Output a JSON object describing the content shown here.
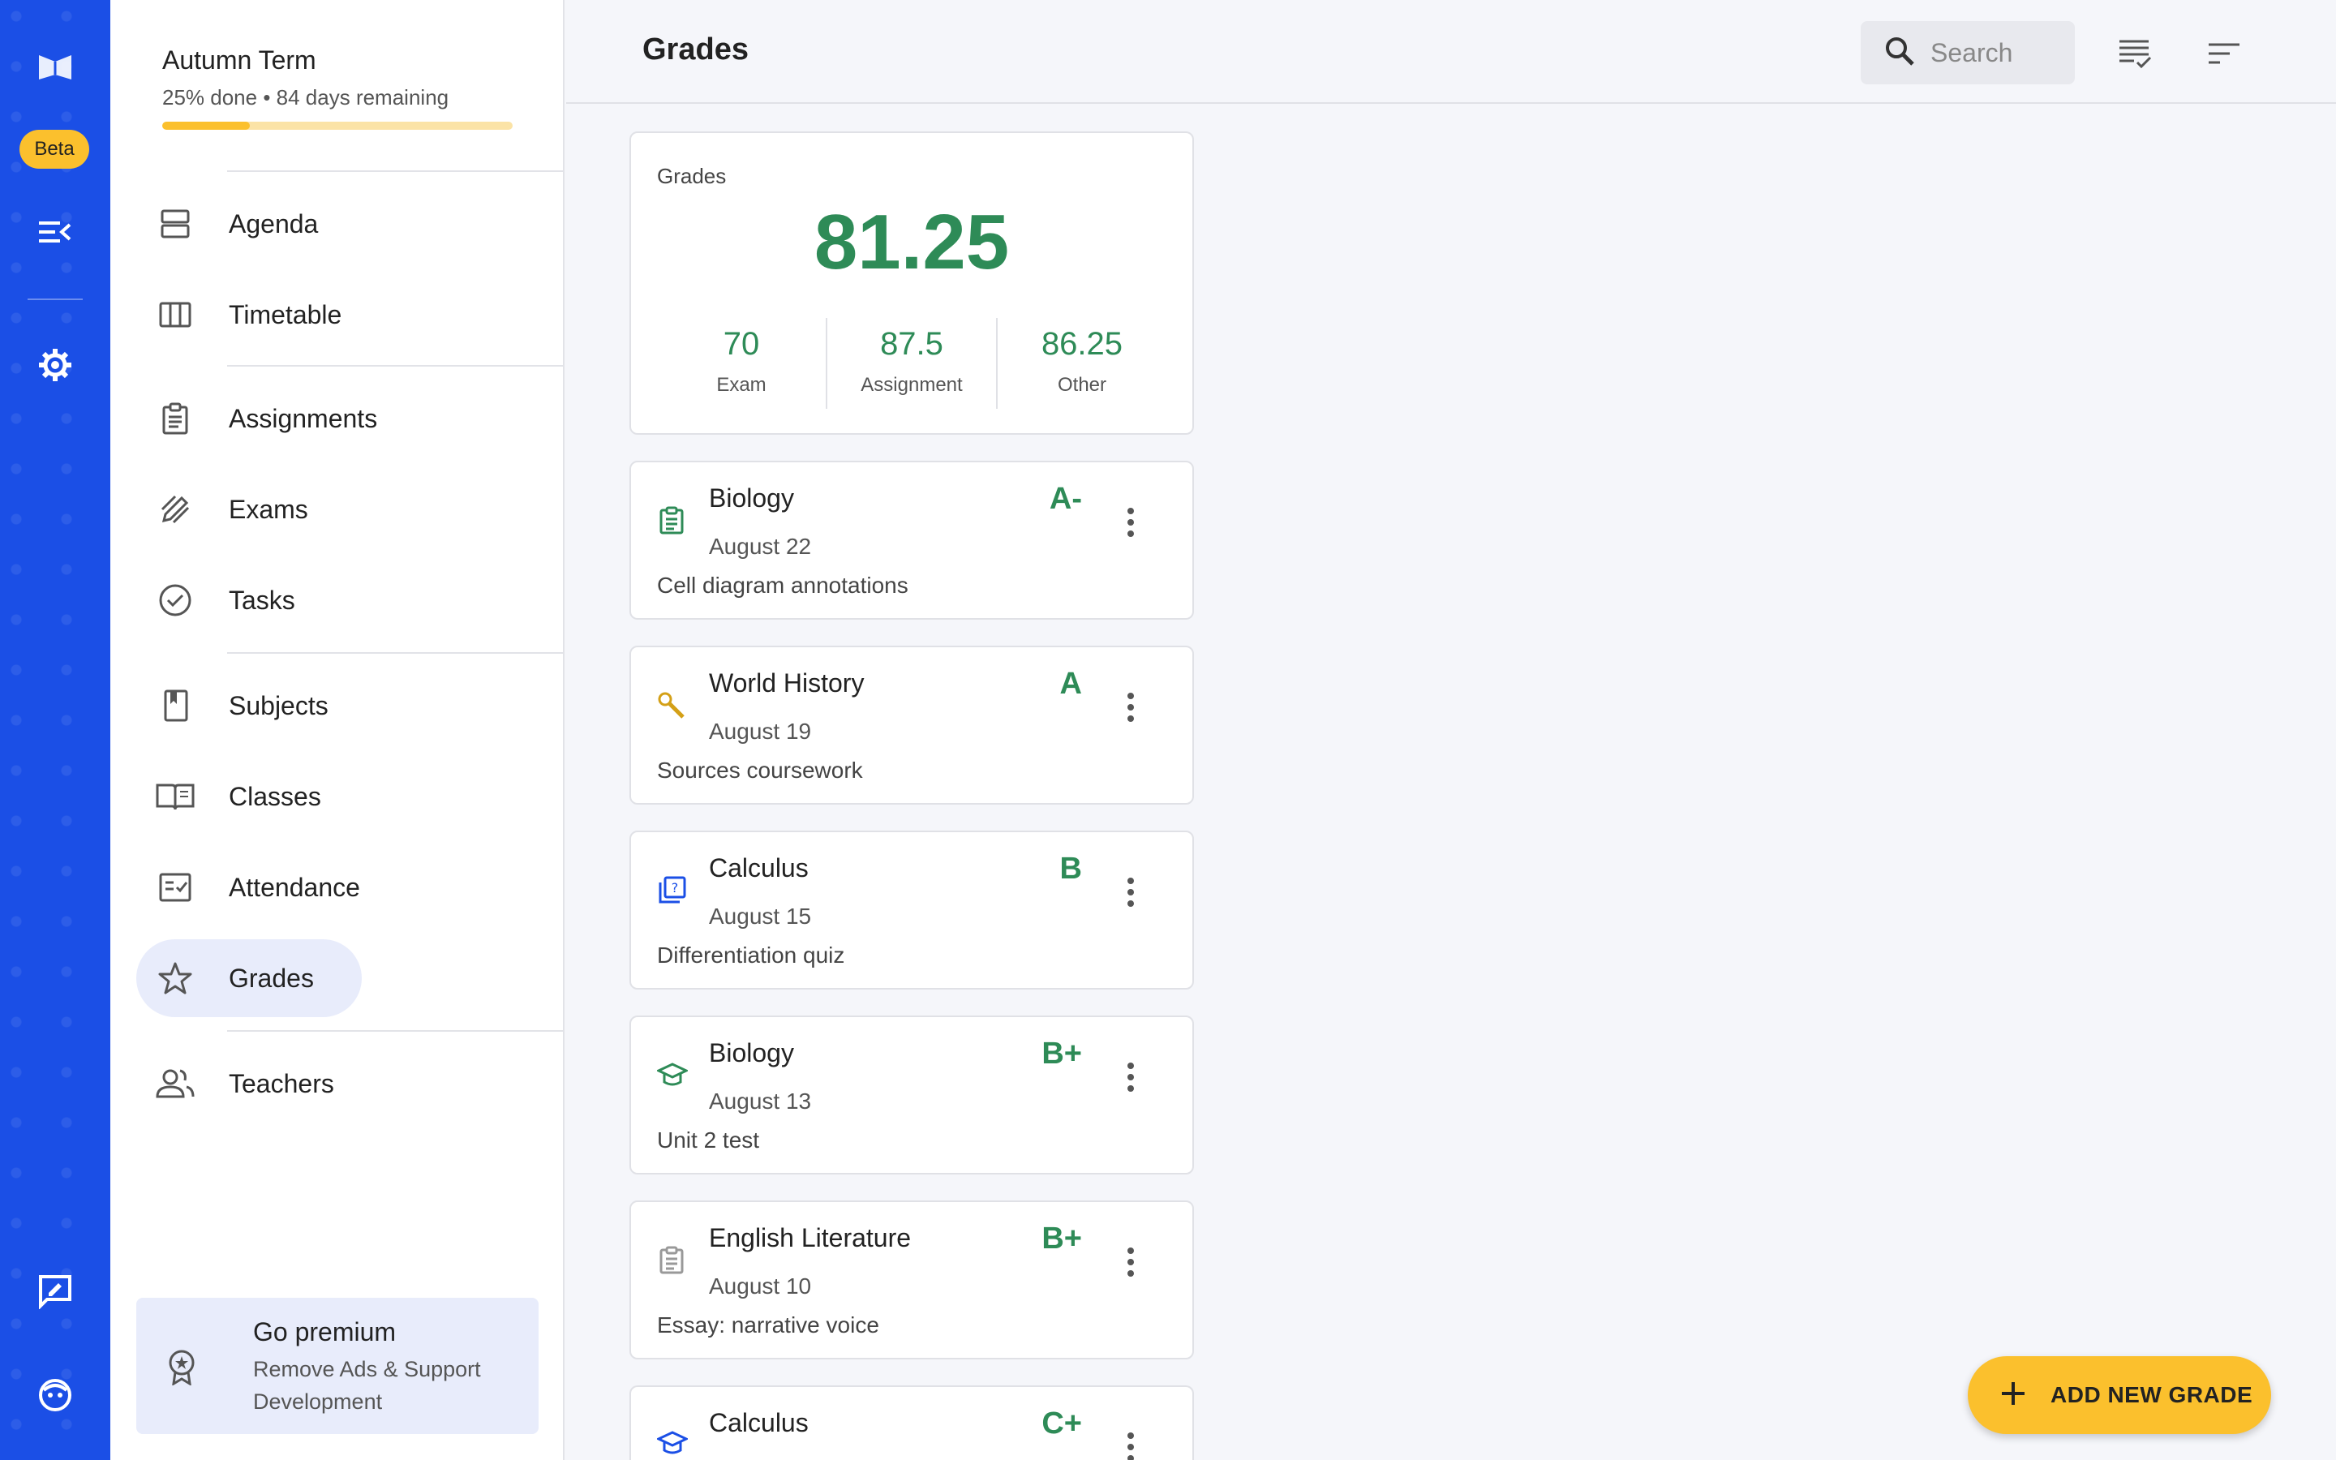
{
  "rail": {
    "beta_label": "Beta"
  },
  "term": {
    "title": "Autumn Term",
    "subtitle": "25% done • 84 days remaining",
    "progress_fraction": 0.25
  },
  "nav": {
    "agenda": "Agenda",
    "timetable": "Timetable",
    "assignments": "Assignments",
    "exams": "Exams",
    "tasks": "Tasks",
    "subjects": "Subjects",
    "classes": "Classes",
    "attendance": "Attendance",
    "grades": "Grades",
    "teachers": "Teachers",
    "active": "Grades"
  },
  "premium": {
    "title": "Go premium",
    "subtitle": "Remove Ads & Support Development"
  },
  "header": {
    "title": "Grades",
    "search_placeholder": "Search"
  },
  "summary": {
    "label": "Grades",
    "overall": "81.25",
    "breakdown": [
      {
        "value": "70",
        "label": "Exam"
      },
      {
        "value": "87.5",
        "label": "Assignment"
      },
      {
        "value": "86.25",
        "label": "Other"
      }
    ]
  },
  "grades": [
    {
      "subject": "Biology",
      "date": "August 22",
      "description": "Cell diagram annotations",
      "grade": "A-",
      "type_icon": "clipboard-icon",
      "icon_color": "#2e8b57"
    },
    {
      "subject": "World History",
      "date": "August 19",
      "description": "Sources coursework",
      "grade": "A",
      "type_icon": "wrench-icon",
      "icon_color": "#d4a017"
    },
    {
      "subject": "Calculus",
      "date": "August 15",
      "description": "Differentiation quiz",
      "grade": "B",
      "type_icon": "quiz-icon",
      "icon_color": "#1b4fe6"
    },
    {
      "subject": "Biology",
      "date": "August 13",
      "description": "Unit 2 test",
      "grade": "B+",
      "type_icon": "graduation-cap-icon",
      "icon_color": "#2e8b57"
    },
    {
      "subject": "English Literature",
      "date": "August 10",
      "description": "Essay: narrative voice",
      "grade": "B+",
      "type_icon": "clipboard-icon",
      "icon_color": "#999999"
    },
    {
      "subject": "Calculus",
      "date": "",
      "description": "",
      "grade": "C+",
      "type_icon": "graduation-cap-icon",
      "icon_color": "#1b4fe6"
    }
  ],
  "fab": {
    "label": "ADD NEW GRADE"
  },
  "colors": {
    "rail": "#1b4fe6",
    "accent_yellow": "#fbc02d",
    "grade_green": "#2e8b57"
  }
}
